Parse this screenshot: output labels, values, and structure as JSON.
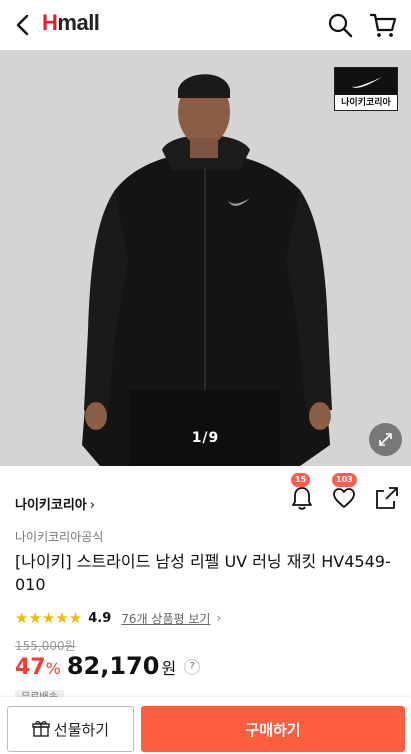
{
  "header": {
    "logo_text": "mall",
    "logo_initial": "H",
    "back_icon": "back-chevron-icon",
    "search_icon": "search-icon",
    "cart_icon": "cart-icon"
  },
  "gallery": {
    "brand_badge_text": "나이키코리아",
    "pager": "1/9",
    "zoom_icon": "expand-icon"
  },
  "product": {
    "brand_link": "나이키코리아",
    "seller": "나이키코리아공식",
    "title": "[나이키] 스트라이드 남성 리펠 UV 러닝 재킷 HV4549-010",
    "stars": "★★★★★",
    "rating": "4.9",
    "review_link": "76개 상품평 보기",
    "original_price": "155,000원",
    "discount": "47",
    "discount_unit": "%",
    "price": "82,170",
    "price_unit": "원",
    "help": "?",
    "shipping_tag": "무료배송"
  },
  "actions": {
    "alarm_count": "15",
    "wish_count": "103"
  },
  "bottom_bar": {
    "gift_label": "선물하기",
    "buy_label": "구매하기"
  },
  "colors": {
    "accent": "#ff5d3f",
    "discount": "#ff3b30",
    "star": "#f6b800",
    "brand_red": "#ec1c2b"
  }
}
